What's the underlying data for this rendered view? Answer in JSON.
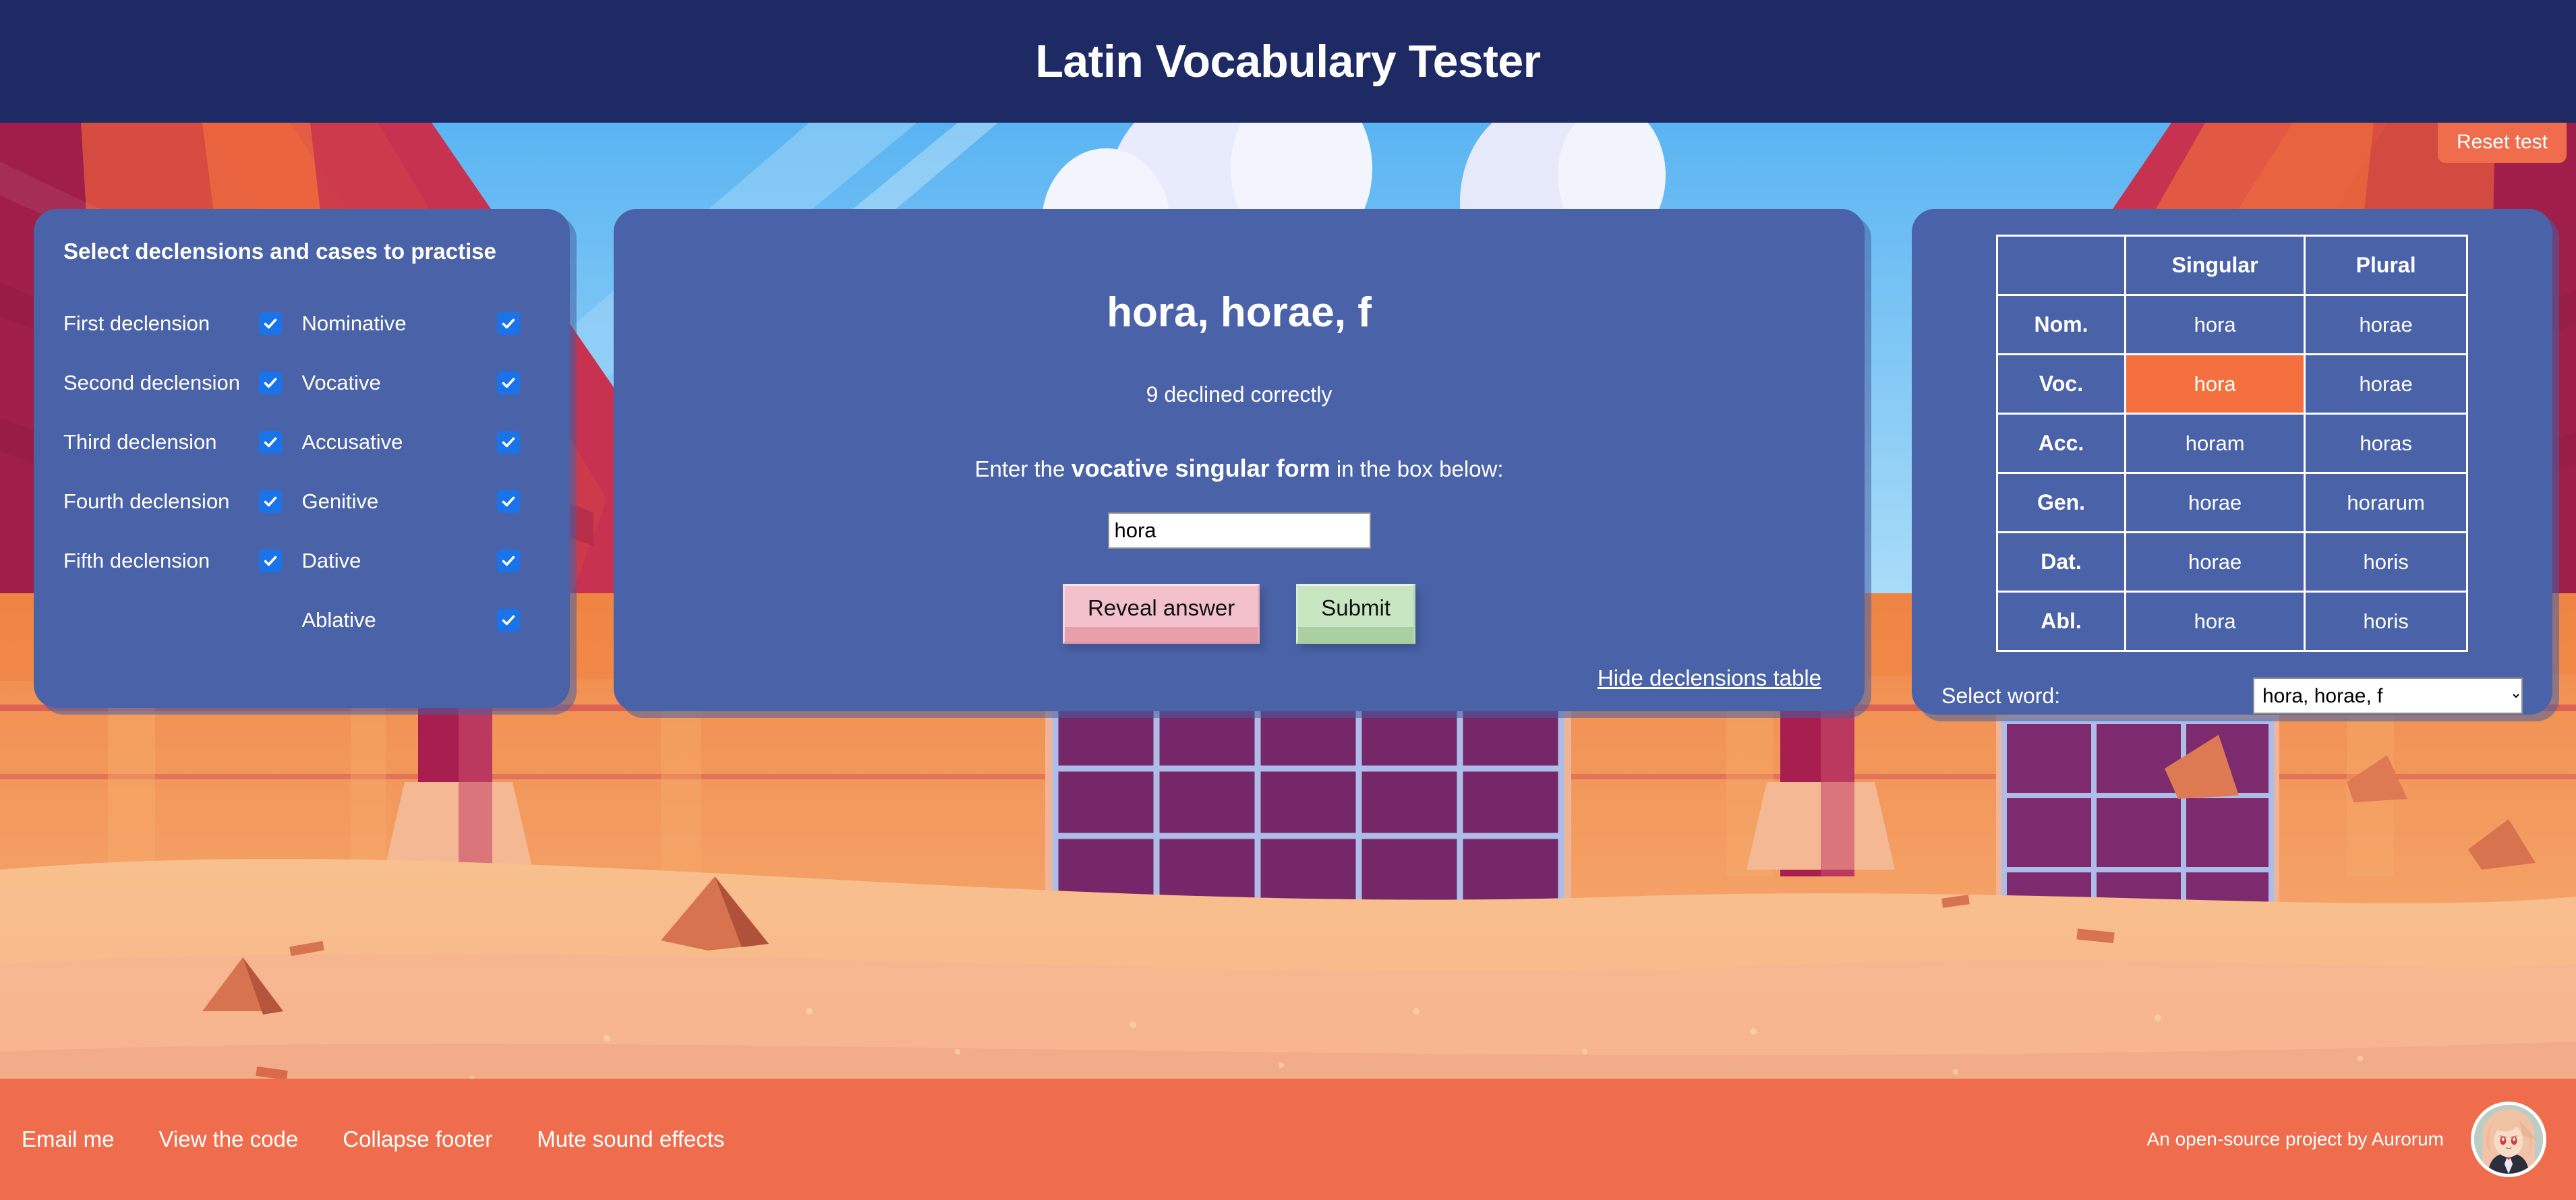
{
  "header": {
    "title": "Latin Vocabulary Tester",
    "bg_color": "#1e2a63",
    "reset_label": "Reset test",
    "reset_color": "#ef6d4d"
  },
  "panel_colors": {
    "card": "#4a62a8",
    "checkbox_accent": "#1a73e8",
    "highlight_cell": "#f4703f",
    "footer": "#ef6d4d"
  },
  "options_panel": {
    "title": "Select declensions and cases to practise",
    "declensions": [
      {
        "label": "First declension",
        "checked": true
      },
      {
        "label": "Second declension",
        "checked": true
      },
      {
        "label": "Third declension",
        "checked": true
      },
      {
        "label": "Fourth declension",
        "checked": true
      },
      {
        "label": "Fifth declension",
        "checked": true
      }
    ],
    "cases": [
      {
        "label": "Nominative",
        "checked": true
      },
      {
        "label": "Vocative",
        "checked": true
      },
      {
        "label": "Accusative",
        "checked": true
      },
      {
        "label": "Genitive",
        "checked": true
      },
      {
        "label": "Dative",
        "checked": true
      },
      {
        "label": "Ablative",
        "checked": true
      }
    ]
  },
  "quiz_panel": {
    "word": "hora, horae, f",
    "score": "9 declined correctly",
    "prompt_prefix": "Enter the ",
    "prompt_bold": "vocative singular form",
    "prompt_suffix": " in the box below:",
    "input_value": "hora",
    "input_placeholder": "",
    "reveal_label": "Reveal answer",
    "submit_label": "Submit",
    "hide_table_label": "Hide declensions table"
  },
  "table_panel": {
    "columns": [
      "",
      "Singular",
      "Plural"
    ],
    "rows": [
      {
        "case": "Nom.",
        "singular": "hora",
        "plural": "horae",
        "highlight": ""
      },
      {
        "case": "Voc.",
        "singular": "hora",
        "plural": "horae",
        "highlight": "singular"
      },
      {
        "case": "Acc.",
        "singular": "horam",
        "plural": "horas",
        "highlight": ""
      },
      {
        "case": "Gen.",
        "singular": "horae",
        "plural": "horarum",
        "highlight": ""
      },
      {
        "case": "Dat.",
        "singular": "horae",
        "plural": "horis",
        "highlight": ""
      },
      {
        "case": "Abl.",
        "singular": "hora",
        "plural": "horis",
        "highlight": ""
      }
    ],
    "select_label": "Select word:",
    "selected_word": "hora, horae, f"
  },
  "footer": {
    "links": [
      "Email me",
      "View the code",
      "Collapse footer",
      "Mute sound effects"
    ],
    "credit": "An open-source project by Aurorum"
  }
}
